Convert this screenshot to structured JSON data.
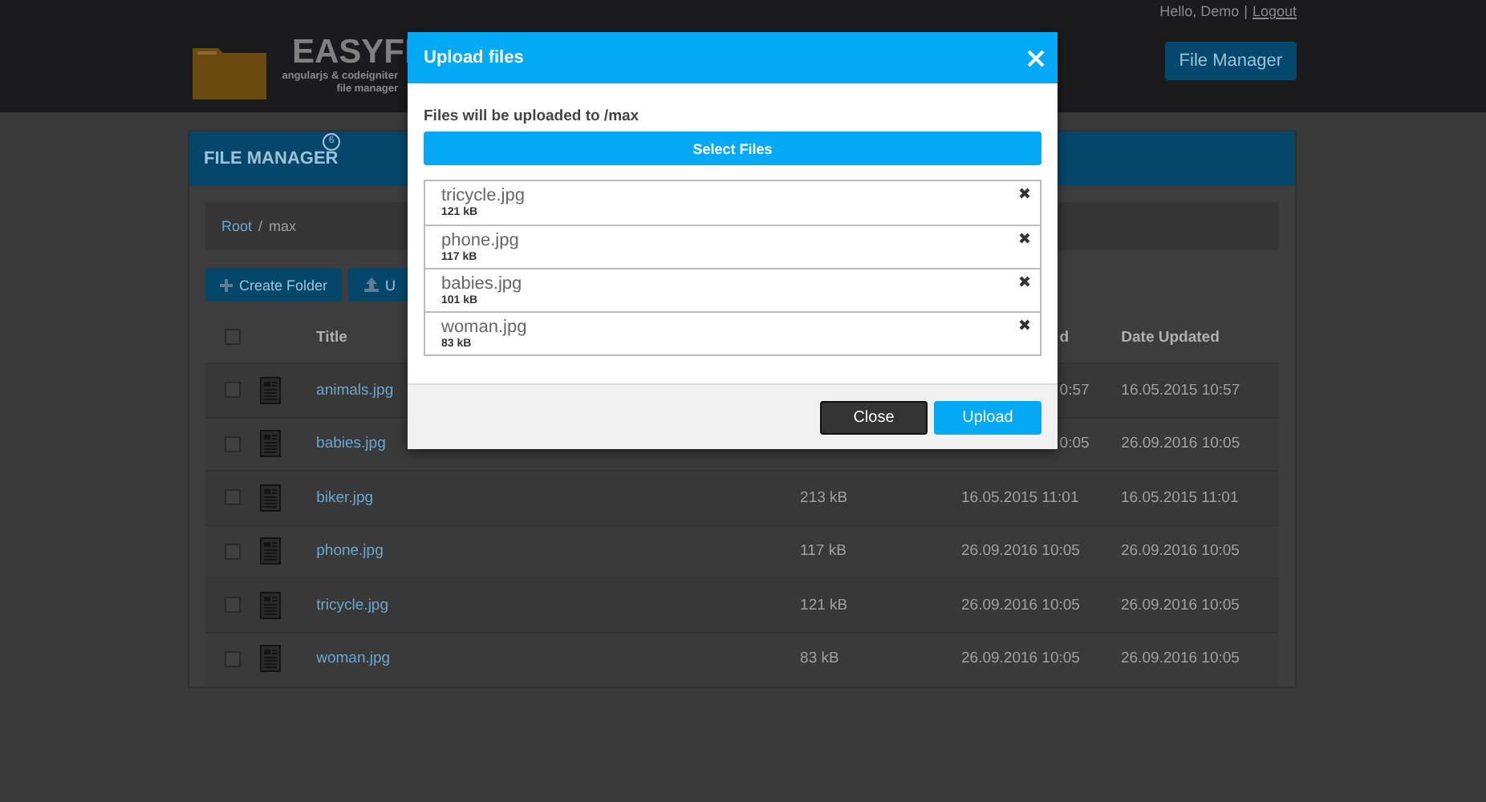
{
  "header": {
    "greeting": "Hello, Demo",
    "separator": "|",
    "logout": "Logout",
    "logo_title": "EASYFI",
    "logo_subtitle": "angularjs & codeigniter",
    "logo_caption": "file manager",
    "nav_button": "File Manager"
  },
  "panel": {
    "title": "FILE MANAGER",
    "badge": "6",
    "breadcrumb": [
      {
        "label": "Root",
        "kind": "link"
      },
      {
        "label": "max",
        "kind": "current"
      }
    ],
    "breadcrumb_separator": "/",
    "buttons": [
      {
        "label": "Create Folder",
        "kind": "create"
      },
      {
        "label": "U",
        "kind": "upload"
      }
    ],
    "table": {
      "select_all_checked": false,
      "columns": {
        "title": "Title",
        "date_created": "d",
        "date_updated": "Date Updated"
      },
      "rows": [
        {
          "checked": false,
          "title": "animals.jpg",
          "date_created": "0:57",
          "date_updated": "16.05.2015 10:57"
        },
        {
          "checked": false,
          "title": "babies.jpg",
          "date_created": "0:05",
          "date_updated": "26.09.2016 10:05"
        },
        {
          "checked": false,
          "title": "biker.jpg",
          "size": "213 kB",
          "date_created": "16.05.2015 11:01",
          "date_updated": "16.05.2015 11:01"
        },
        {
          "checked": false,
          "title": "phone.jpg",
          "size": "117 kB",
          "date_created": "26.09.2016 10:05",
          "date_updated": "26.09.2016 10:05"
        },
        {
          "checked": false,
          "title": "tricycle.jpg",
          "size": "121 kB",
          "date_created": "26.09.2016 10:05",
          "date_updated": "26.09.2016 10:05"
        },
        {
          "checked": false,
          "title": "woman.jpg",
          "size": "83 kB",
          "date_created": "26.09.2016 10:05",
          "date_updated": "26.09.2016 10:05"
        }
      ]
    }
  },
  "modal": {
    "title": "Upload files",
    "destination": "Files will be uploaded to /max",
    "select_button": "Select Files",
    "files": [
      {
        "name": "tricycle.jpg",
        "size": "121 kB"
      },
      {
        "name": "phone.jpg",
        "size": "117 kB"
      },
      {
        "name": "babies.jpg",
        "size": "101 kB"
      },
      {
        "name": "woman.jpg",
        "size": "83 kB"
      }
    ],
    "buttons": [
      {
        "label": "Close",
        "kind": "secondary"
      },
      {
        "label": "Upload",
        "kind": "primary"
      }
    ]
  }
}
